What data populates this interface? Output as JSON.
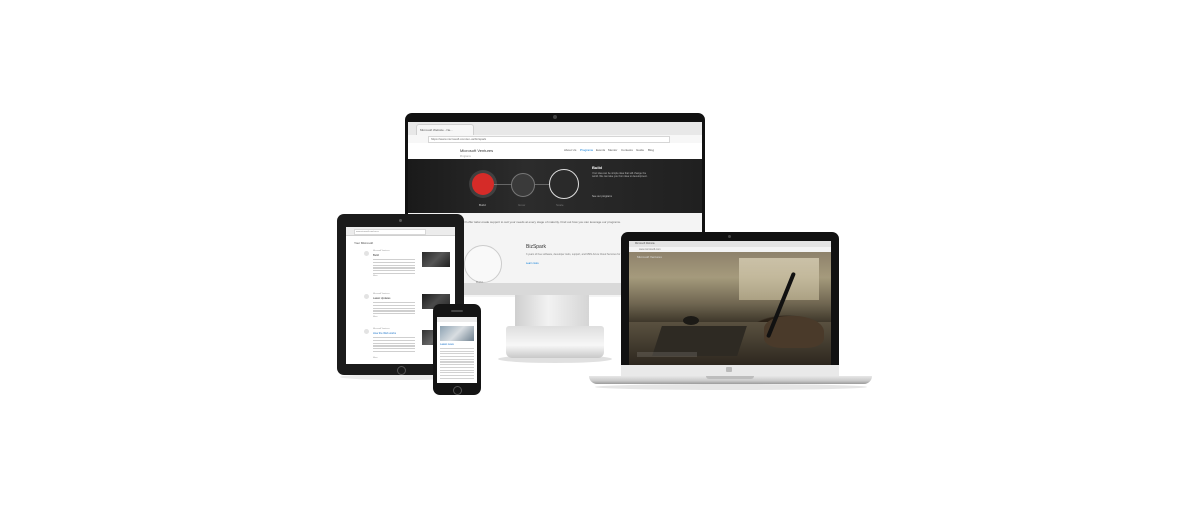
{
  "monitor": {
    "tab_title": "Microsoft Website - Ne...",
    "url": "https://www.microsoft.com/en-us/bizspark",
    "site_title": "Microsoft Ventures",
    "subnav": "Programs",
    "nav": [
      "About Us",
      "Programs",
      "Events",
      "Mentor",
      "Contests",
      "Guide",
      "Blog"
    ],
    "hero": {
      "title": "Build",
      "text": "Your idea can be simple idea that will change the world. We can take you from idea to development.",
      "link": "See our programs",
      "captions": [
        "Build",
        "Grow",
        "Scale"
      ]
    },
    "intro": "Every startup is unique. We'll offer tailor-made support to suit your needs at every stage of maturity. Find out how you can leverage our programs.",
    "card": {
      "circle_label": "Build",
      "title": "BizSpark",
      "text": "3 years of free software, developer tools, support, and MSN Azure Cloud Services for qualifying startups.",
      "link": "Learn more"
    }
  },
  "tablet": {
    "url": "www.microsoft.com/en-us",
    "heading": "Your Microsoft",
    "entries": [
      {
        "meta": "Microsoft Ventures",
        "title": "Build",
        "more": "More"
      },
      {
        "meta": "Microsoft Ventures",
        "title": "Latest Updates",
        "more": "More"
      },
      {
        "meta": "Microsoft Ventures",
        "title": "How the Web works",
        "more": "More"
      }
    ]
  },
  "phone": {
    "title": "Latest news"
  },
  "laptop": {
    "tab": "Microsoft Website",
    "url": "www.microsoft.com",
    "logo": "Microsoft Ventures"
  }
}
